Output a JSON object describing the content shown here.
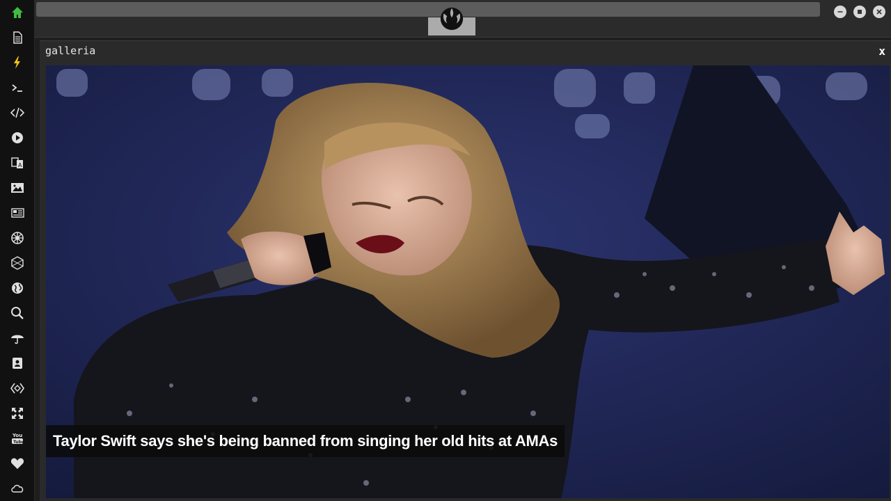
{
  "window": {
    "title": "galleria",
    "close_label": "x"
  },
  "sidebar": {
    "items": [
      {
        "icon": "home-icon"
      },
      {
        "icon": "document-icon"
      },
      {
        "icon": "lightning-icon"
      },
      {
        "icon": "terminal-icon"
      },
      {
        "icon": "code-icon"
      },
      {
        "icon": "play-icon"
      },
      {
        "icon": "translate-icon"
      },
      {
        "icon": "image-icon"
      },
      {
        "icon": "newspaper-icon"
      },
      {
        "icon": "galactic-empire-icon"
      },
      {
        "icon": "hexagon-icon"
      },
      {
        "icon": "globe-icon"
      },
      {
        "icon": "search-icon"
      },
      {
        "icon": "umbrella-icon"
      },
      {
        "icon": "contact-card-icon"
      },
      {
        "icon": "code-diamond-icon"
      },
      {
        "icon": "expand-icon"
      },
      {
        "icon": "youtube-icon"
      },
      {
        "icon": "heart-icon"
      },
      {
        "icon": "cloud-icon"
      }
    ]
  },
  "gallery": {
    "caption": "Taylor Swift says she's being banned from singing her old hits at AMAs"
  },
  "colors": {
    "active_icon": "#3fbf3f",
    "accent_icon": "#f2c21b",
    "icon": "#e0e0e0"
  }
}
